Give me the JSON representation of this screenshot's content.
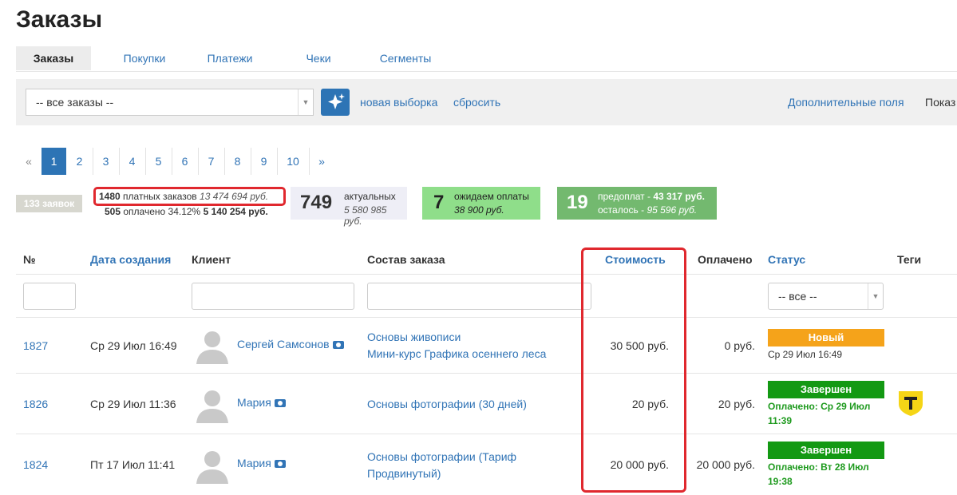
{
  "page_title": "Заказы",
  "tabs": [
    "Заказы",
    "Покупки",
    "Платежи",
    "Чеки",
    "Сегменты"
  ],
  "toolbar": {
    "filter_select": "-- все заказы --",
    "new_selection": "новая выборка",
    "reset": "сбросить",
    "extra_fields": "Дополнительные поля",
    "show": "Показ"
  },
  "pagination": [
    "«",
    "1",
    "2",
    "3",
    "4",
    "5",
    "6",
    "7",
    "8",
    "9",
    "10",
    "»"
  ],
  "stats": {
    "requests_badge": "133 заявок",
    "paid_count": "1480",
    "paid_label": "платных заказов",
    "paid_sum": "13 474 694 руб.",
    "paid_done_count": "505",
    "paid_done_label": "оплачено 34.12%",
    "paid_done_sum": "5 140 254 руб.",
    "actual_count": "749",
    "actual_label": "актуальных",
    "actual_sum": "5 580 985 руб.",
    "waiting_count": "7",
    "waiting_label": "ожидаем оплаты",
    "waiting_sum": "38 900 руб.",
    "prepay_count": "19",
    "prepay_label": "предоплат -",
    "prepay_sum": "43 317 руб.",
    "remaining_label": "осталось -",
    "remaining_sum": "95 596 руб."
  },
  "columns": [
    "№",
    "Дата создания",
    "Клиент",
    "Состав заказа",
    "Стоимость",
    "Оплачено",
    "Статус",
    "Теги"
  ],
  "status_filter": "-- все --",
  "orders": [
    {
      "id": "1827",
      "date": "Ср 29 Июл 16:49",
      "client": "Сергей Самсонов",
      "items": [
        "Основы живописи",
        "Мини-курс Графика осеннего леса"
      ],
      "cost": "30 500 руб.",
      "paid": "0 руб.",
      "status": "Новый",
      "status_color": "#f5a31a",
      "status_note": "Ср 29 Июл 16:49"
    },
    {
      "id": "1826",
      "date": "Ср 29 Июл 11:36",
      "client": "Мария",
      "items": [
        "Основы фотографии (30 дней)"
      ],
      "cost": "20 руб.",
      "paid": "20 руб.",
      "status": "Завершен",
      "status_color": "#139913",
      "status_note_1": "Оплачено: Ср 29 Июл",
      "status_note_2": "11:39",
      "tag_icon": "tinkoff-logo-icon"
    },
    {
      "id": "1824",
      "date": "Пт 17 Июл 11:41",
      "client": "Мария",
      "items": [
        "Основы фотографии (Тариф",
        "Продвинутый)"
      ],
      "cost": "20 000 руб.",
      "paid": "20 000 руб.",
      "status": "Завершен",
      "status_color": "#139913",
      "status_note_1": "Оплачено: Вт 28 Июл",
      "status_note_2": "19:38"
    }
  ]
}
